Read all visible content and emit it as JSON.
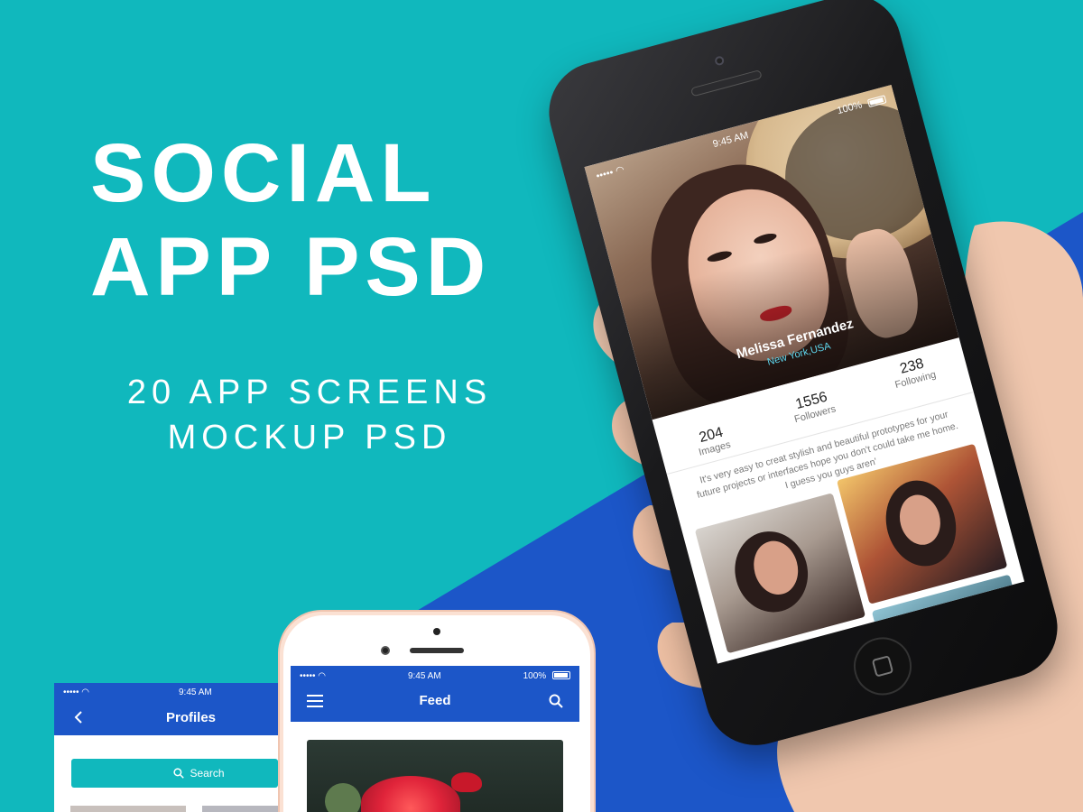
{
  "colors": {
    "teal_background": "#10b8bd",
    "blue_background": "#1c56c8",
    "accent_location": "#5fd7ee"
  },
  "headline": {
    "line1": "SOCIAL",
    "line2": "APP PSD"
  },
  "subline": {
    "line1": "20 APP SCREENS",
    "line2": "MOCKUP PSD"
  },
  "profile_screen": {
    "status": {
      "time": "9:45 AM",
      "battery": "100%"
    },
    "name": "Melissa Fernandez",
    "location": "New York,USA",
    "stats": [
      {
        "value": "204",
        "label": "Images"
      },
      {
        "value": "1556",
        "label": "Followers"
      },
      {
        "value": "238",
        "label": "Following"
      }
    ],
    "bio": "It's very easy to creat stylish and beautiful prototypes for your future projects or interfaces hope you don't could take me home. I guess you guys aren'"
  },
  "feed_screen": {
    "status": {
      "time": "9:45 AM",
      "battery": "100%"
    },
    "title": "Feed",
    "menu_icon": "hamburger-icon",
    "search_icon": "search-icon"
  },
  "profiles_screen": {
    "status": {
      "time": "9:45 AM"
    },
    "title": "Profiles",
    "back_icon": "chevron-left-icon",
    "search_label": "Search"
  }
}
